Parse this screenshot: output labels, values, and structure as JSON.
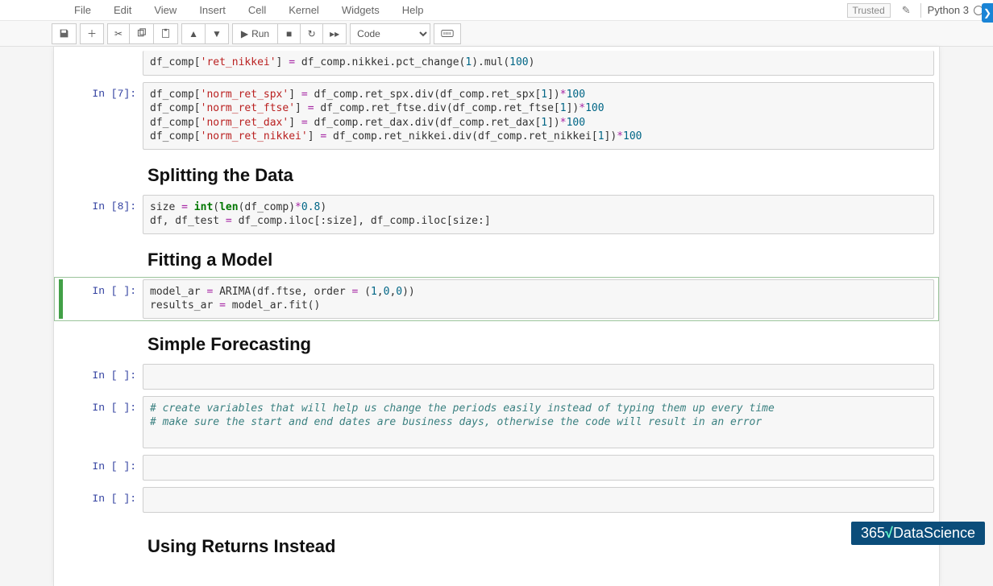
{
  "menubar": {
    "items": [
      "File",
      "Edit",
      "View",
      "Insert",
      "Cell",
      "Kernel",
      "Widgets",
      "Help"
    ],
    "trusted": "Trusted",
    "kernel_name": "Python 3"
  },
  "toolbar": {
    "run_label": "Run",
    "cell_type": "Code"
  },
  "cells": {
    "c0_prompt": "",
    "c7_prompt": "In [7]:",
    "c8_prompt": "In [8]:",
    "csel_prompt": "In [ ]:",
    "cempty_prompt": "In [ ]:",
    "h_split": "Splitting the Data",
    "h_fit": "Fitting a Model",
    "h_forecast": "Simple Forecasting",
    "h_returns": "Using Returns Instead",
    "code8_line1_a": "size ",
    "code8_line1_eq": "=",
    "code8_line1_b": " ",
    "code8_line1_int": "int",
    "code8_line1_c": "(",
    "code8_line1_len": "len",
    "code8_line1_d": "(df_comp)",
    "code8_line1_mul": "*",
    "code8_line1_num": "0.8",
    "code8_line1_e": ")",
    "comment1": "# create variables that will help us change the periods easily instead of typing them up every time",
    "comment2": "# make sure the start and end dates are business days, otherwise the code will result in an error"
  },
  "watermark": {
    "a": "365",
    "b": "DataScience"
  }
}
